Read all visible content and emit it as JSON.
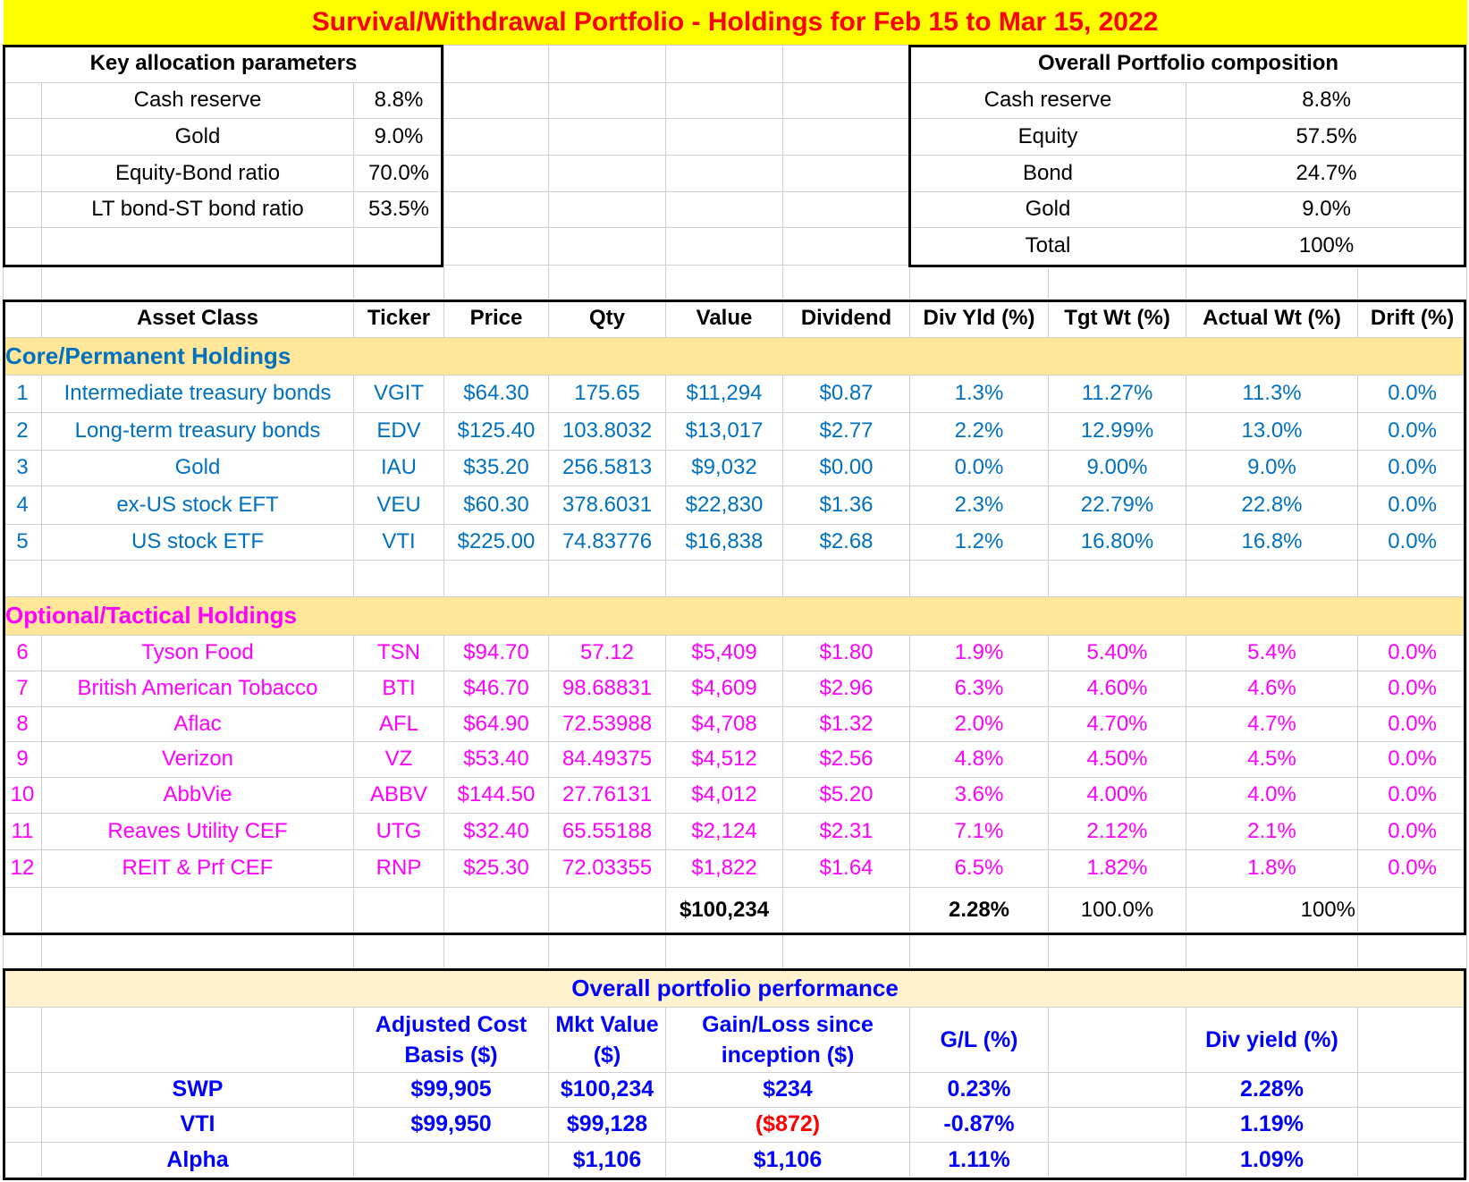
{
  "title": "Survival/Withdrawal Portfolio - Holdings for Feb 15 to Mar 15, 2022",
  "key_params": {
    "header": "Key allocation parameters",
    "rows": [
      {
        "label": "Cash reserve",
        "value": "8.8%"
      },
      {
        "label": "Gold",
        "value": "9.0%"
      },
      {
        "label": "Equity-Bond ratio",
        "value": "70.0%"
      },
      {
        "label": "LT bond-ST bond ratio",
        "value": "53.5%"
      }
    ]
  },
  "composition": {
    "header": "Overall Portfolio composition",
    "rows": [
      {
        "label": "Cash reserve",
        "value": "8.8%"
      },
      {
        "label": "Equity",
        "value": "57.5%"
      },
      {
        "label": "Bond",
        "value": "24.7%"
      },
      {
        "label": "Gold",
        "value": "9.0%"
      },
      {
        "label": "Total",
        "value": "100%"
      }
    ]
  },
  "holdings": {
    "columns": [
      "Asset Class",
      "Ticker",
      "Price",
      "Qty",
      "Value",
      "Dividend",
      "Div Yld (%)",
      "Tgt Wt (%)",
      "Actual Wt (%)",
      "Drift (%)"
    ],
    "core_label": "Core/Permanent Holdings",
    "core": [
      [
        "1",
        "Intermediate treasury bonds",
        "VGIT",
        "$64.30",
        "175.65",
        "$11,294",
        "$0.87",
        "1.3%",
        "11.27%",
        "11.3%",
        "0.0%"
      ],
      [
        "2",
        "Long-term treasury bonds",
        "EDV",
        "$125.40",
        "103.8032",
        "$13,017",
        "$2.77",
        "2.2%",
        "12.99%",
        "13.0%",
        "0.0%"
      ],
      [
        "3",
        "Gold",
        "IAU",
        "$35.20",
        "256.5813",
        "$9,032",
        "$0.00",
        "0.0%",
        "9.00%",
        "9.0%",
        "0.0%"
      ],
      [
        "4",
        "ex-US stock EFT",
        "VEU",
        "$60.30",
        "378.6031",
        "$22,830",
        "$1.36",
        "2.3%",
        "22.79%",
        "22.8%",
        "0.0%"
      ],
      [
        "5",
        "US stock ETF",
        "VTI",
        "$225.00",
        "74.83776",
        "$16,838",
        "$2.68",
        "1.2%",
        "16.80%",
        "16.8%",
        "0.0%"
      ]
    ],
    "optional_label": "Optional/Tactical Holdings",
    "optional": [
      [
        "6",
        "Tyson Food",
        "TSN",
        "$94.70",
        "57.12",
        "$5,409",
        "$1.80",
        "1.9%",
        "5.40%",
        "5.4%",
        "0.0%"
      ],
      [
        "7",
        "British American Tobacco",
        "BTI",
        "$46.70",
        "98.68831",
        "$4,609",
        "$2.96",
        "6.3%",
        "4.60%",
        "4.6%",
        "0.0%"
      ],
      [
        "8",
        "Aflac",
        "AFL",
        "$64.90",
        "72.53988",
        "$4,708",
        "$1.32",
        "2.0%",
        "4.70%",
        "4.7%",
        "0.0%"
      ],
      [
        "9",
        "Verizon",
        "VZ",
        "$53.40",
        "84.49375",
        "$4,512",
        "$2.56",
        "4.8%",
        "4.50%",
        "4.5%",
        "0.0%"
      ],
      [
        "10",
        "AbbVie",
        "ABBV",
        "$144.50",
        "27.76131",
        "$4,012",
        "$5.20",
        "3.6%",
        "4.00%",
        "4.0%",
        "0.0%"
      ],
      [
        "11",
        "Reaves Utility CEF",
        "UTG",
        "$32.40",
        "65.55188",
        "$2,124",
        "$2.31",
        "7.1%",
        "2.12%",
        "2.1%",
        "0.0%"
      ],
      [
        "12",
        "REIT & Prf CEF",
        "RNP",
        "$25.30",
        "72.03355",
        "$1,822",
        "$1.64",
        "6.5%",
        "1.82%",
        "1.8%",
        "0.0%"
      ]
    ],
    "totals": {
      "value": "$100,234",
      "div_yld": "2.28%",
      "tgt_wt": "100.0%",
      "actual_wt": "100%"
    }
  },
  "performance": {
    "header": "Overall portfolio performance",
    "columns": [
      "Adjusted Cost Basis ($)",
      "Mkt Value ($)",
      "Gain/Loss since inception ($)",
      "G/L (%)",
      "Div yield (%)"
    ],
    "rows": [
      {
        "label": "SWP",
        "cost": "$99,905",
        "mkt": "$100,234",
        "gl": "$234",
        "gl_pct": "0.23%",
        "div": "2.28%",
        "negative": false
      },
      {
        "label": "VTI",
        "cost": "$99,950",
        "mkt": "$99,128",
        "gl": "($872)",
        "gl_pct": "-0.87%",
        "div": "1.19%",
        "negative": true
      },
      {
        "label": "Alpha",
        "cost": "",
        "mkt": "$1,106",
        "gl": "$1,106",
        "gl_pct": "1.11%",
        "div": "1.09%",
        "negative": false
      }
    ]
  }
}
